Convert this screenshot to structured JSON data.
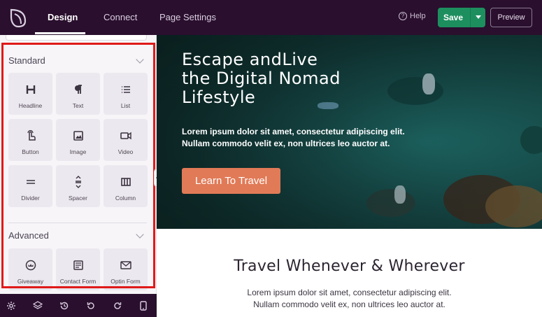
{
  "header": {
    "tabs": [
      {
        "label": "Design"
      },
      {
        "label": "Connect"
      },
      {
        "label": "Page Settings"
      }
    ],
    "help_label": "Help",
    "save_label": "Save",
    "preview_label": "Preview"
  },
  "sidebar": {
    "standard": {
      "title": "Standard",
      "blocks": [
        {
          "label": "Headline",
          "icon": "headline-icon"
        },
        {
          "label": "Text",
          "icon": "text-icon"
        },
        {
          "label": "List",
          "icon": "list-icon"
        },
        {
          "label": "Button",
          "icon": "button-icon"
        },
        {
          "label": "Image",
          "icon": "image-icon"
        },
        {
          "label": "Video",
          "icon": "video-icon"
        },
        {
          "label": "Divider",
          "icon": "divider-icon"
        },
        {
          "label": "Spacer",
          "icon": "spacer-icon"
        },
        {
          "label": "Column",
          "icon": "column-icon"
        }
      ]
    },
    "advanced": {
      "title": "Advanced",
      "blocks": [
        {
          "label": "Giveaway",
          "icon": "giveaway-icon"
        },
        {
          "label": "Contact Form",
          "icon": "contact-form-icon"
        },
        {
          "label": "Optin Form",
          "icon": "optin-form-icon"
        }
      ]
    }
  },
  "hero": {
    "title_line1": "Escape andLive",
    "title_line2": "the Digital Nomad",
    "title_line3": "Lifestyle",
    "body_line1": "Lorem ipsum dolor sit amet, consectetur adipiscing elit.",
    "body_line2": "Nullam commodo velit ex, non ultrices leo auctor at.",
    "button_label": "Learn To Travel"
  },
  "section": {
    "title": "Travel Whenever & Wherever",
    "body_line1": "Lorem ipsum dolor sit amet, consectetur adipiscing elit.",
    "body_line2": "Nullam commodo velit ex, non ultrices leo auctor at."
  },
  "colors": {
    "topbar": "#2a0f2e",
    "save": "#1d8f5f",
    "accent_button": "#e17a57",
    "highlight_outline": "#e01a1a"
  }
}
